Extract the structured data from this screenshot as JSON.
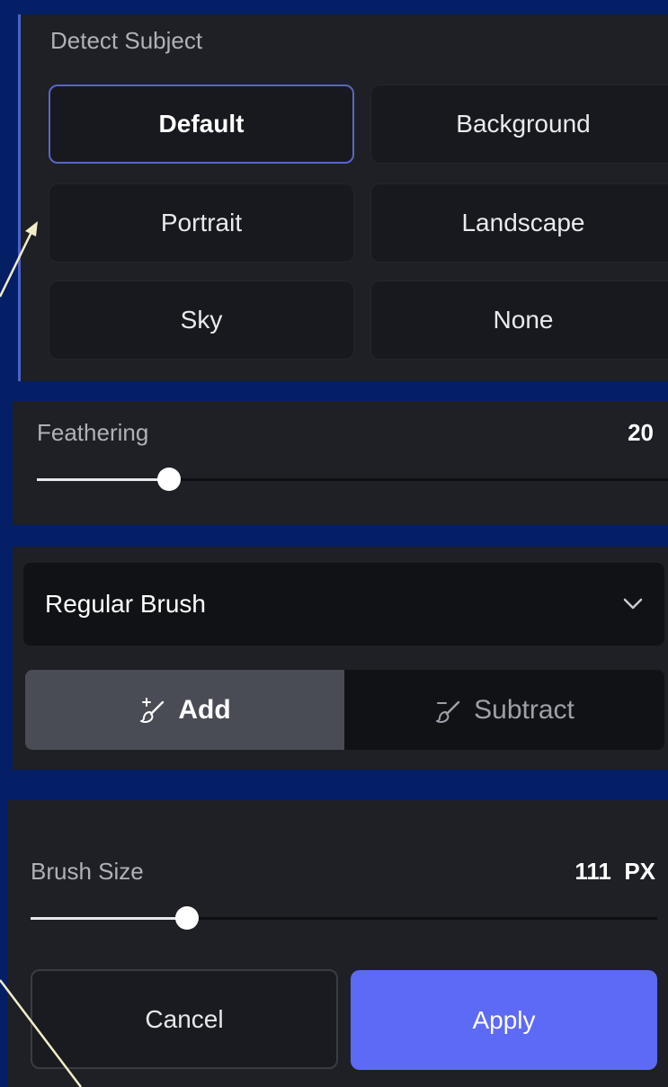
{
  "detect_subject": {
    "title": "Detect Subject",
    "options": [
      "Default",
      "Background",
      "Portrait",
      "Landscape",
      "Sky",
      "None"
    ],
    "selected": "Default"
  },
  "feathering": {
    "label": "Feathering",
    "value": "20",
    "level": 0.21
  },
  "brush": {
    "type": "Regular Brush",
    "modes": {
      "add": "Add",
      "subtract": "Subtract"
    },
    "selected_mode": "Add"
  },
  "brush_size": {
    "label": "Brush Size",
    "value": "111",
    "unit": "PX",
    "level": 0.25
  },
  "actions": {
    "cancel": "Cancel",
    "apply": "Apply"
  },
  "colors": {
    "accent": "#5d6af5",
    "background": "#041f66",
    "panel": "#1e2026"
  }
}
